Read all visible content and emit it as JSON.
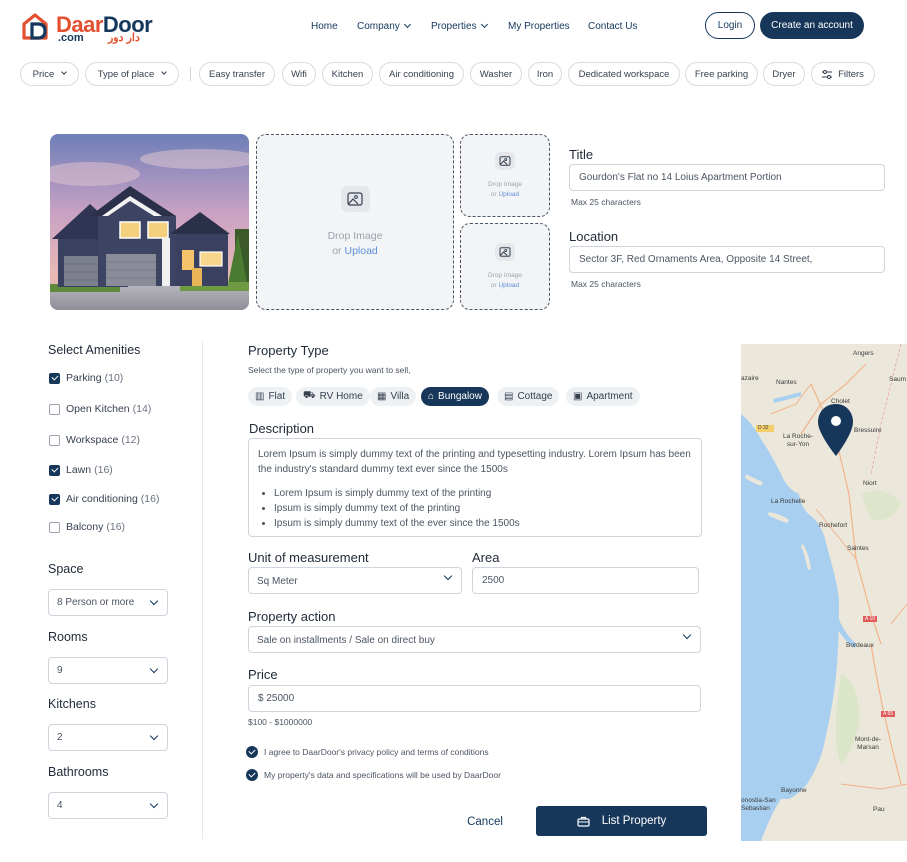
{
  "brand": {
    "name_part1": "Daar",
    "name_part2": "Door",
    "suffix": ".com",
    "arabic": "دار دور"
  },
  "nav": {
    "home": "Home",
    "company": "Company",
    "properties": "Properties",
    "my_properties": "My Properties",
    "contact": "Contact Us"
  },
  "auth": {
    "login": "Login",
    "create": "Create an account"
  },
  "filters": {
    "price": "Price",
    "type_of_place": "Type of place",
    "chips": [
      "Easy transfer",
      "Wifi",
      "Kitchen",
      "Air conditioning",
      "Washer",
      "Iron",
      "Dedicated workspace",
      "Free parking",
      "Dryer"
    ],
    "filters_label": "Filters"
  },
  "upload": {
    "drop": "Drop Image",
    "or": "or",
    "upload": "Upload"
  },
  "title_field": {
    "label": "Title",
    "value": "Gourdon's Flat no 14 Loius Apartment Portion",
    "hint": "Max 25 characters"
  },
  "location_field": {
    "label": "Location",
    "value": "Sector 3F, Red Ornaments Area, Opposite 14 Street,",
    "hint": "Max 25 characters"
  },
  "amenities": {
    "title": "Select Amenities",
    "items": [
      {
        "label": "Parking",
        "count": "(10)",
        "checked": true
      },
      {
        "label": "Open Kitchen",
        "count": "(14)",
        "checked": false
      },
      {
        "label": "Workspace",
        "count": "(12)",
        "checked": false
      },
      {
        "label": "Lawn",
        "count": "(16)",
        "checked": true
      },
      {
        "label": "Air conditioning",
        "count": "(16)",
        "checked": true
      },
      {
        "label": "Balcony",
        "count": "(16)",
        "checked": false
      }
    ]
  },
  "space": {
    "label": "Space",
    "value": "8 Person or more"
  },
  "rooms": {
    "label": "Rooms",
    "value": "9"
  },
  "kitchens": {
    "label": "Kitchens",
    "value": "2"
  },
  "bathrooms": {
    "label": "Bathrooms",
    "value": "4"
  },
  "property_type": {
    "label": "Property Type",
    "hint": "Select the type of property you want to sell,",
    "options": [
      "Flat",
      "RV Home",
      "Villa",
      "Bungalow",
      "Cottage",
      "Apartment"
    ],
    "selected": "Bungalow"
  },
  "description": {
    "label": "Description",
    "text": "Lorem Ipsum is simply dummy text of the printing and typesetting industry. Lorem Ipsum has been the industry's standard dummy text ever since the 1500s",
    "bullets": [
      "Lorem Ipsum is simply dummy text of the printing",
      "Ipsum is simply dummy text of the printing",
      "Ipsum is simply dummy text of the  ever since the 1500s"
    ]
  },
  "unit": {
    "label": "Unit of measurement",
    "value": "Sq Meter"
  },
  "area": {
    "label": "Area",
    "value": "2500"
  },
  "action": {
    "label": "Property action",
    "value": "Sale on installments / Sale on direct buy"
  },
  "price": {
    "label": "Price",
    "value": "$ 25000",
    "hint": "$100 - $1000000"
  },
  "agreements": [
    "I agree to DaarDoor's privacy policy and terms of conditions",
    "My property's data and specifications will be used by DaarDoor"
  ],
  "actions": {
    "cancel": "Cancel",
    "list": "List Property"
  },
  "map": {
    "labels": [
      "Angers",
      "Saum",
      "Nantes",
      "azaire",
      "Cholet",
      "D 32",
      "La Roche-sur-Yon",
      "Bressuire",
      "Niort",
      "La Rochelle",
      "Rochefort",
      "Saintes",
      "A 10",
      "Bordeaux",
      "A 65",
      "Mont-de-Marsan",
      "Bayonne",
      "onostia-San Sebastian",
      "Pau"
    ]
  },
  "colors": {
    "primary": "#17375a",
    "accent": "#e4502f",
    "link": "#5b8fd9"
  }
}
